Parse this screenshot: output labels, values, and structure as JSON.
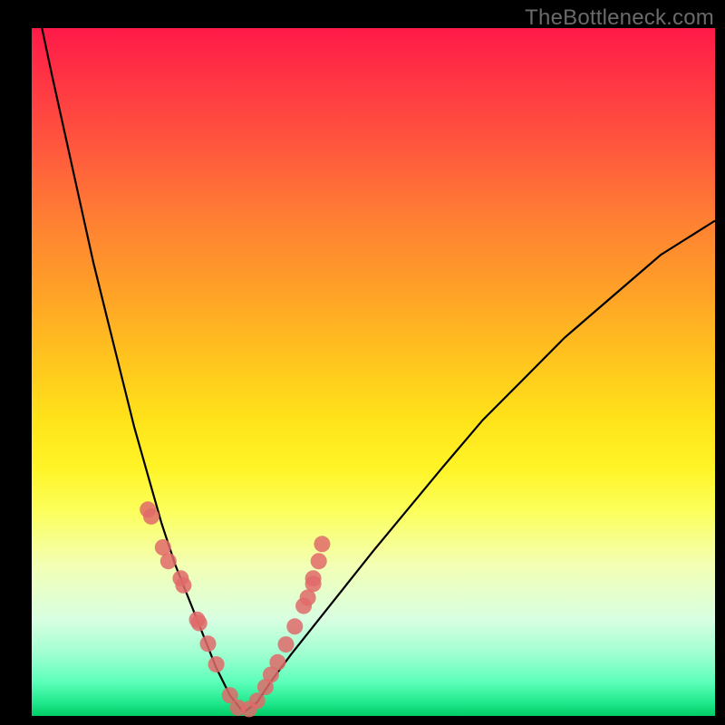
{
  "watermark": "TheBottleneck.com",
  "colors": {
    "background": "#000000",
    "watermark_text": "#6a6a6a",
    "curve": "#000000",
    "dot_fill": "#e06a6a",
    "gradient_top": "#ff1a48",
    "gradient_bottom": "#00cc66"
  },
  "chart_data": {
    "type": "line",
    "title": "",
    "xlabel": "",
    "ylabel": "",
    "xlim": [
      0,
      1
    ],
    "ylim": [
      0,
      1
    ],
    "legend": false,
    "annotations": [
      "TheBottleneck.com"
    ],
    "description": "V-shaped bottleneck curve; minimum near x≈0.31 where value ≈ 0. Left arm rises steeply toward 1 near x=0; right arm rises gradually toward ≈0.72 at x=1. Data markers cluster on both arms around y in 0.06–0.30.",
    "series": [
      {
        "name": "bottleneck-curve",
        "x": [
          0.015,
          0.03,
          0.05,
          0.07,
          0.09,
          0.11,
          0.13,
          0.15,
          0.17,
          0.19,
          0.21,
          0.23,
          0.25,
          0.27,
          0.29,
          0.31,
          0.33,
          0.35,
          0.38,
          0.42,
          0.46,
          0.5,
          0.55,
          0.6,
          0.66,
          0.72,
          0.78,
          0.85,
          0.92,
          1.0
        ],
        "y": [
          1.0,
          0.93,
          0.84,
          0.75,
          0.66,
          0.58,
          0.5,
          0.42,
          0.35,
          0.28,
          0.22,
          0.17,
          0.12,
          0.07,
          0.03,
          0.005,
          0.02,
          0.05,
          0.09,
          0.14,
          0.19,
          0.24,
          0.3,
          0.36,
          0.43,
          0.49,
          0.55,
          0.61,
          0.67,
          0.72
        ]
      },
      {
        "name": "data-points",
        "x": [
          0.17,
          0.175,
          0.192,
          0.2,
          0.218,
          0.222,
          0.242,
          0.245,
          0.258,
          0.27,
          0.29,
          0.302,
          0.318,
          0.33,
          0.342,
          0.35,
          0.36,
          0.372,
          0.385,
          0.398,
          0.404,
          0.412,
          0.412,
          0.42,
          0.425
        ],
        "y": [
          0.3,
          0.29,
          0.245,
          0.225,
          0.2,
          0.19,
          0.14,
          0.135,
          0.105,
          0.075,
          0.03,
          0.012,
          0.01,
          0.022,
          0.042,
          0.06,
          0.078,
          0.104,
          0.13,
          0.16,
          0.172,
          0.192,
          0.2,
          0.225,
          0.25
        ]
      }
    ]
  }
}
